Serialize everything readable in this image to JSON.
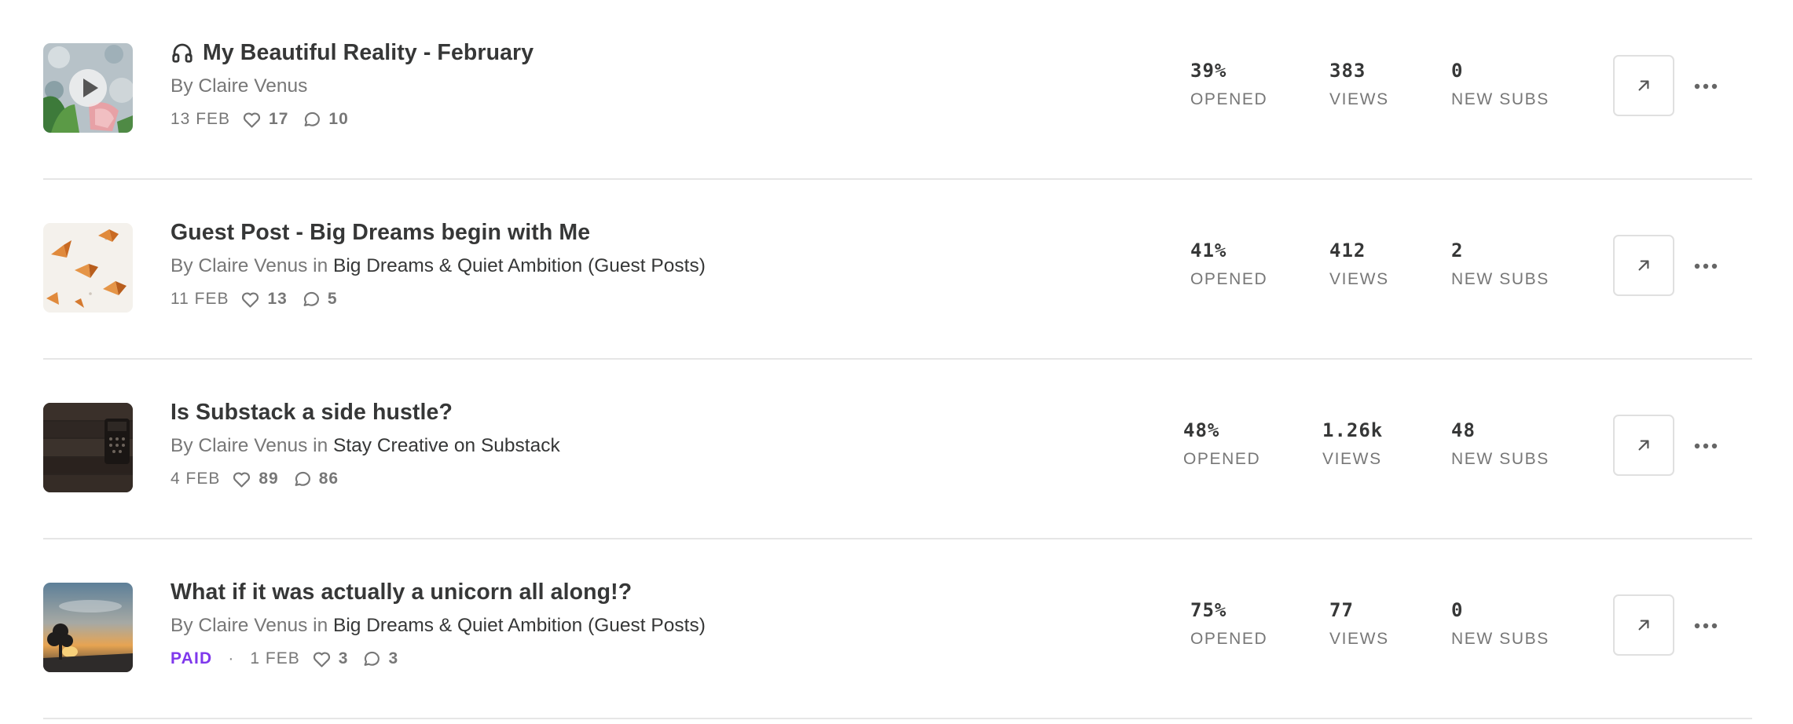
{
  "posts": [
    {
      "title": "My Beautiful Reality - February",
      "audio": true,
      "by_prefix": "By ",
      "author": "Claire Venus",
      "in_word": "",
      "publication": "",
      "paid": "",
      "date": "13 FEB",
      "likes": "17",
      "comments": "10",
      "opened": "39%",
      "opened_label": "OPENED",
      "views": "383",
      "views_label": "VIEWS",
      "new_subs": "0",
      "new_subs_label": "NEW SUBS",
      "thumb_icon": "play-icon"
    },
    {
      "title": "Guest Post - Big Dreams begin with Me",
      "audio": false,
      "by_prefix": "By ",
      "author": "Claire Venus",
      "in_word": " in ",
      "publication": "Big Dreams & Quiet Ambition (Guest Posts)",
      "paid": "",
      "date": "11 FEB",
      "likes": "13",
      "comments": "5",
      "opened": "41%",
      "opened_label": "OPENED",
      "views": "412",
      "views_label": "VIEWS",
      "new_subs": "2",
      "new_subs_label": "NEW SUBS"
    },
    {
      "title": "Is Substack a side hustle?",
      "audio": false,
      "by_prefix": "By ",
      "author": "Claire Venus",
      "in_word": " in ",
      "publication": "Stay Creative on Substack",
      "paid": "",
      "date": "4 FEB",
      "likes": "89",
      "comments": "86",
      "opened": "48%",
      "opened_label": "OPENED",
      "views": "1.26k",
      "views_label": "VIEWS",
      "new_subs": "48",
      "new_subs_label": "NEW SUBS"
    },
    {
      "title": "What if it was actually a unicorn all along!?",
      "audio": false,
      "by_prefix": "By ",
      "author": "Claire Venus",
      "in_word": " in ",
      "publication": "Big Dreams & Quiet Ambition (Guest Posts)",
      "paid": "PAID",
      "date": "1 FEB",
      "likes": "3",
      "comments": "3",
      "opened": "75%",
      "opened_label": "OPENED",
      "views": "77",
      "views_label": "VIEWS",
      "new_subs": "0",
      "new_subs_label": "NEW SUBS"
    }
  ],
  "icons": {
    "audio": "headphones-icon",
    "likes": "heart-icon",
    "comments": "comment-bubble-icon",
    "open": "arrow-up-right-icon",
    "more": "more-horizontal-icon"
  },
  "colors": {
    "paid_accent": "#7f38ec",
    "text_primary": "#363737",
    "text_secondary": "#777777",
    "divider": "#e6e6e6"
  }
}
